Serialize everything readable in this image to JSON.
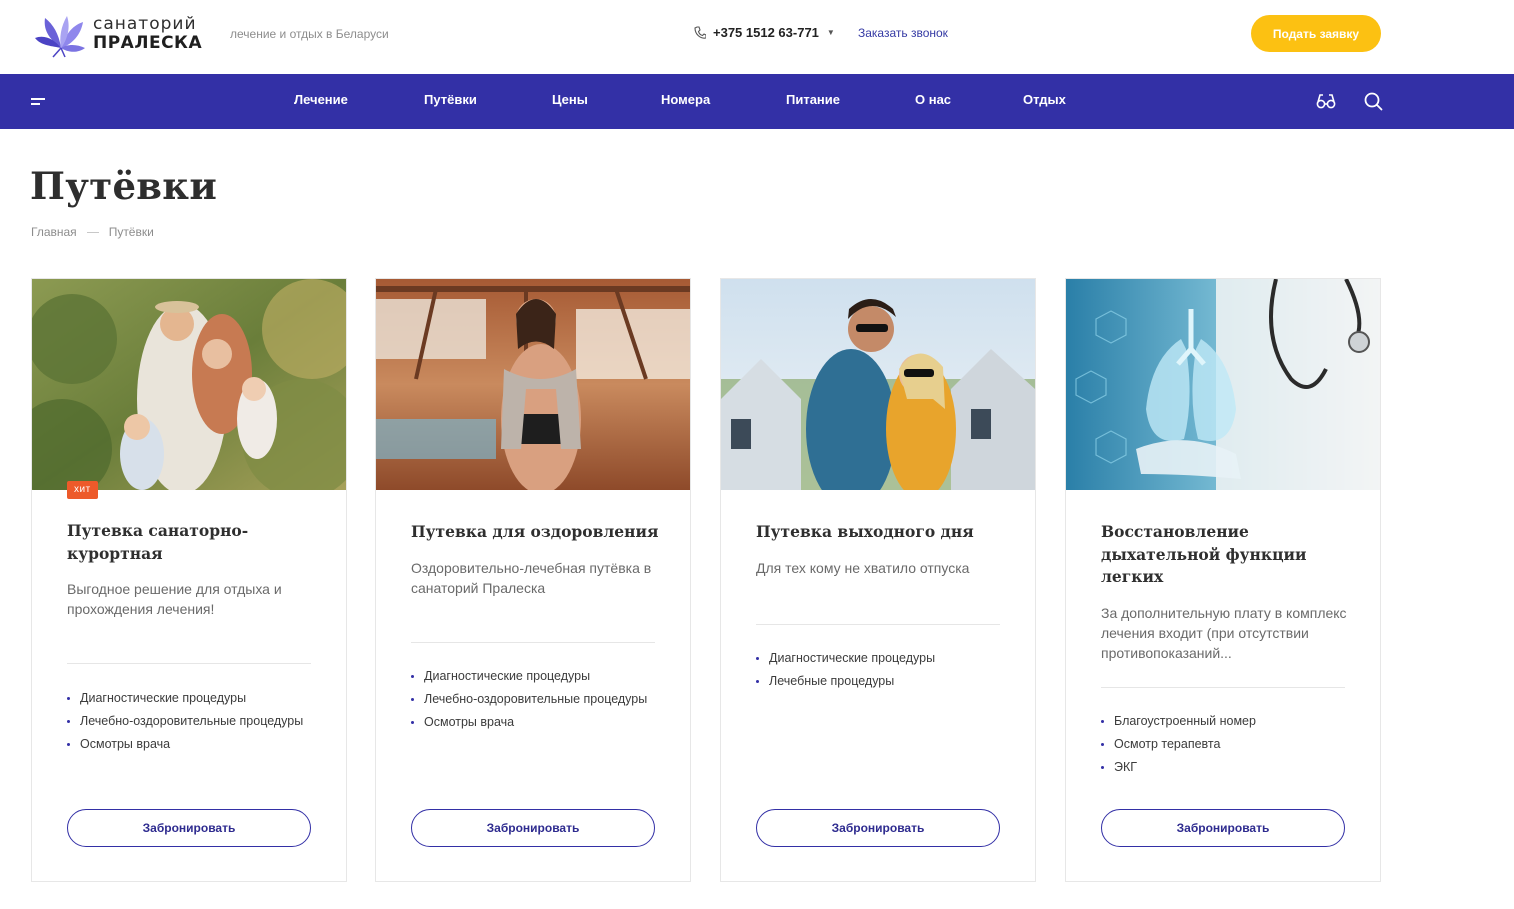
{
  "header": {
    "logo_line1": "санаторий",
    "logo_line2": "ПРАЛЕСКА",
    "tagline": "лечение и отдых в Беларуси",
    "phone": "+375 1512 63-771",
    "callback_label": "Заказать звонок",
    "apply_label": "Подать заявку"
  },
  "nav": {
    "items": [
      "Лечение",
      "Путёвки",
      "Цены",
      "Номера",
      "Питание",
      "О нас",
      "Отдых"
    ],
    "icons": [
      "menu-icon",
      "glasses-icon",
      "search-icon"
    ]
  },
  "page": {
    "title": "Путёвки",
    "breadcrumb": [
      "Главная",
      "Путёвки"
    ]
  },
  "cards": [
    {
      "badge": "хит",
      "title": "Путевка санаторно-курортная",
      "description": "Выгодное решение для отдыха и прохождения лечения!",
      "features": [
        "Диагностические процедуры",
        "Лечебно-оздоровительные процедуры",
        "Осмотры врача"
      ],
      "button": "Забронировать",
      "image": "family-outdoors-photo"
    },
    {
      "title": "Путевка для оздоровления",
      "description": "Оздоровительно-лечебная путёвка в санаторий Пралеска",
      "features": [
        "Диагностические процедуры",
        "Лечебно-оздоровительные процедуры",
        "Осмотры врача"
      ],
      "button": "Забронировать",
      "image": "woman-with-towel-photo"
    },
    {
      "title": "Путевка выходного дня",
      "description": "Для тех кому не хватило отпуска",
      "features": [
        "Диагностические процедуры",
        "Лечебные процедуры"
      ],
      "button": "Забронировать",
      "image": "couple-in-sunglasses-photo"
    },
    {
      "title": "Восстановление дыхательной функции легких",
      "description": "За дополнительную плату в комплекс лечения входит (при отсутствии противопоказаний...",
      "features": [
        "Благоустроенный номер",
        "Осмотр терапевта",
        "ЭКГ"
      ],
      "button": "Забронировать",
      "image": "lungs-doctor-photo"
    }
  ],
  "colors": {
    "brand": "#3330a6",
    "accent_yellow": "#fcc112",
    "badge": "#ed5a2a"
  }
}
